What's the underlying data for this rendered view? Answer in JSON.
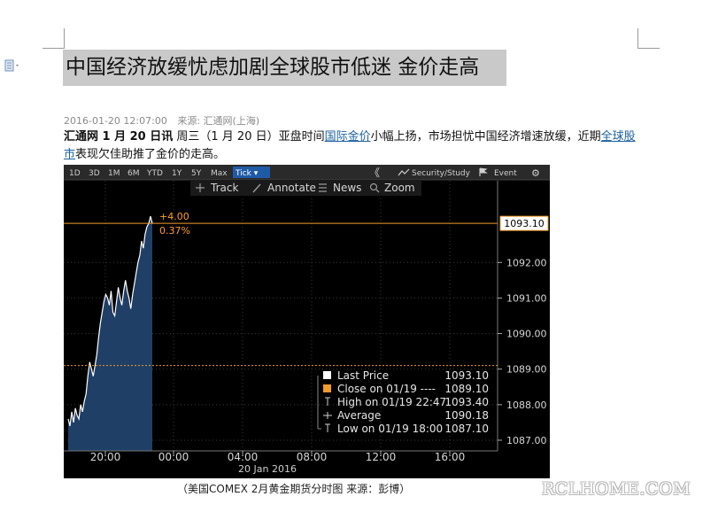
{
  "article": {
    "title": "中国经济放缓忧虑加剧全球股市低迷 金价走高",
    "date": "2016-01-20 12:07:00",
    "source": "来源: 汇通网(上海)",
    "lead": "汇通网 1 月 20 日讯",
    "p1": " 周三（1 月 20 日）亚盘时间",
    "link1": "国际金价",
    "p2": "小幅上扬，市场担忧中国经济增速放缓，近期",
    "link2": "全球股市",
    "p3": "表现欠佳助推了金价的走高。",
    "caption": "（美国COMEX 2月黄金期货分时图 来源：彭博）"
  },
  "watermark": "RCLHOME.COM",
  "chart_toolbar": {
    "ranges": [
      "1D",
      "3D",
      "1M",
      "6M",
      "YTD",
      "1Y",
      "5Y",
      "Max",
      "Tick ▾"
    ],
    "collapse": "《",
    "security": "Security/Study",
    "event": "Event",
    "gear": "⚙",
    "tools": [
      "Track",
      "Annotate",
      "News",
      "Zoom"
    ]
  },
  "chart_data": {
    "type": "line",
    "title": "",
    "xlabel": "",
    "ylabel": "",
    "x_ticks": [
      "20:00",
      "00:00",
      "04:00",
      "08:00",
      "12:00",
      "16:00"
    ],
    "x_sublabel": "20 Jan 2016",
    "y_ticks": [
      "1092.00",
      "1091.00",
      "1090.00",
      "1089.00",
      "1088.00",
      "1087.00"
    ],
    "ylim": [
      1086.7,
      1094.3
    ],
    "last_price": "1093.10",
    "last_value": 1093.1,
    "prev_close": 1089.1,
    "change": "+4.00",
    "change_pct": "0.37%",
    "grid": true,
    "series": [
      {
        "values": [
          1087.6,
          1087.4,
          1087.8,
          1087.5,
          1087.9,
          1087.7,
          1087.6,
          1088.0,
          1087.8,
          1088.1,
          1088.3,
          1088.8,
          1089.2,
          1089.0,
          1088.8,
          1089.1,
          1089.4,
          1089.9,
          1090.3,
          1090.6,
          1090.9,
          1091.1,
          1091.0,
          1090.8,
          1091.2,
          1090.6,
          1090.5,
          1090.9,
          1091.3,
          1091.0,
          1090.8,
          1091.2,
          1091.5,
          1091.2,
          1091.0,
          1090.7,
          1091.1,
          1091.4,
          1091.7,
          1092.0,
          1092.2,
          1092.6,
          1092.4,
          1092.8,
          1093.0,
          1093.1,
          1093.3,
          1093.1
        ]
      }
    ]
  },
  "legend": {
    "items": [
      {
        "label": "Last Price",
        "value": "1093.10"
      },
      {
        "label": "Close on 01/19 ----",
        "value": "1089.10"
      },
      {
        "label": "High on 01/19 22:47",
        "value": "1093.40"
      },
      {
        "label": "Average",
        "value": "1090.18"
      },
      {
        "label": "Low on 01/19 18:00",
        "value": "1087.10"
      }
    ],
    "colors": {
      "last": "#ffffff",
      "close": "#f29b2a",
      "accent": "#ff9d2e",
      "area": "#1f3f66"
    }
  }
}
